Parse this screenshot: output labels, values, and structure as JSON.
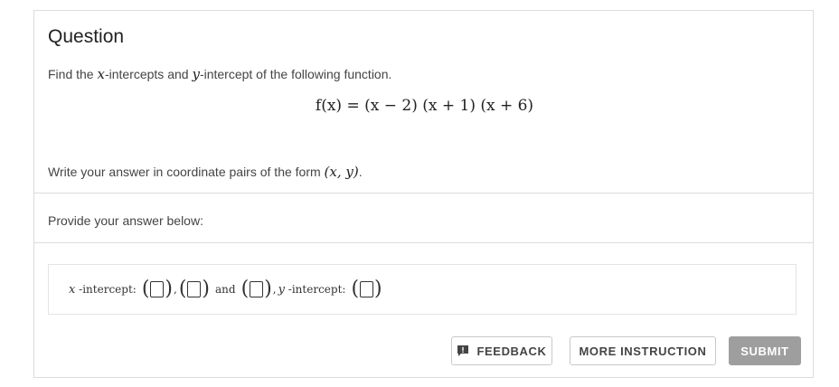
{
  "question": {
    "title": "Question",
    "prompt_pre": "Find the ",
    "prompt_x": "x",
    "prompt_mid": "-intercepts and ",
    "prompt_y": "y",
    "prompt_post": "-intercept of the following function.",
    "formula": "f(x) = (x − 2) (x + 1) (x + 6)",
    "instruction_text": "Write your answer in coordinate pairs of the form ",
    "instruction_form": "(x, y)",
    "instruction_end": "."
  },
  "answer": {
    "provide_label": "Provide your answer below:",
    "x_var": "x",
    "x_label": " -intercept:",
    "comma_1": ",",
    "comma_2": ",",
    "and_label": "and",
    "comma_3": ",",
    "y_var": "y",
    "y_label": " -intercept:"
  },
  "buttons": {
    "feedback": "FEEDBACK",
    "more_instruction": "MORE INSTRUCTION",
    "submit": "SUBMIT"
  },
  "colors": {
    "submit_bg": "#9e9e9e",
    "border": "#dcdcdc",
    "text": "#444444"
  }
}
